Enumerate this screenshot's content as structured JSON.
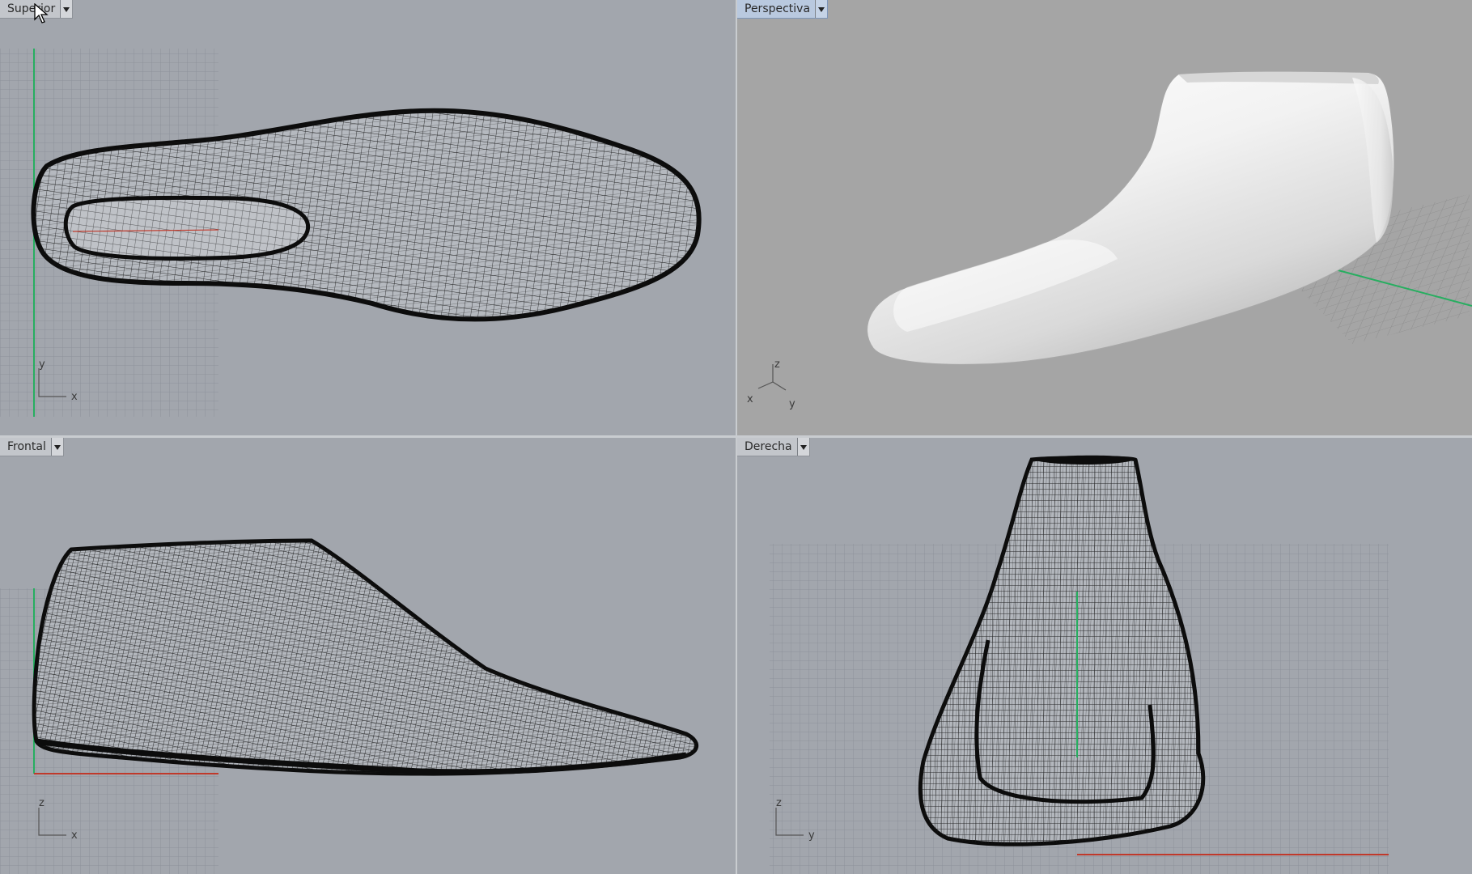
{
  "viewports": {
    "top": {
      "label": "Superior",
      "axis_h": "x",
      "axis_v": "y"
    },
    "persp": {
      "label": "Perspectiva",
      "axis_a": "z",
      "axis_b": "x",
      "axis_c": "y"
    },
    "front": {
      "label": "Frontal",
      "axis_h": "x",
      "axis_v": "z"
    },
    "right": {
      "label": "Derecha",
      "axis_h": "y",
      "axis_v": "z"
    }
  },
  "colors": {
    "viewport_bg": "#a2a6ad",
    "perspective_bg": "#a5a5a5",
    "grid": "#8d929a",
    "x_axis": "#c0392b",
    "y_axis": "#27ae60",
    "wireframe": "#111111",
    "active_tab": "#b9c9df"
  },
  "icons": {
    "cursor": "arrow-cursor-icon",
    "dropdown": "chevron-down-icon"
  }
}
